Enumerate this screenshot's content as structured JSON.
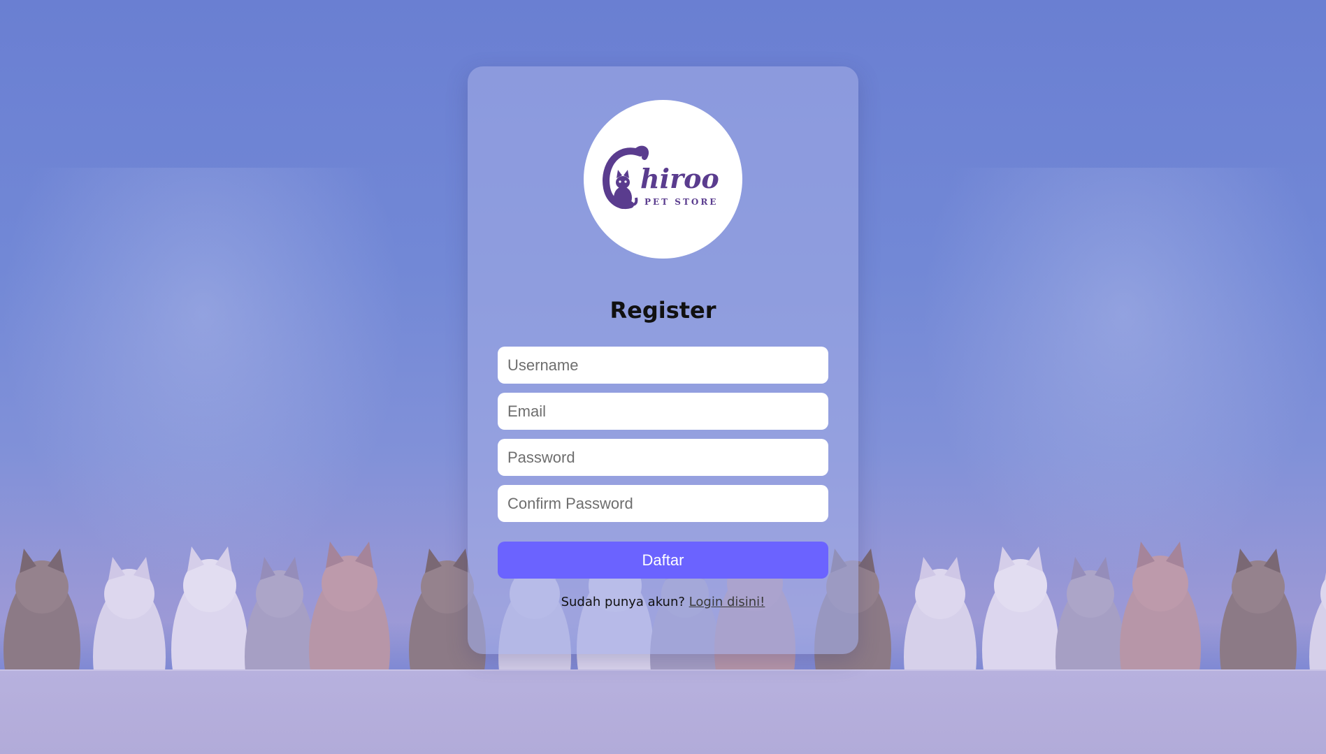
{
  "logo": {
    "brand_text": "hiroo",
    "tagline": "PET STORE",
    "icon": "cat-icon"
  },
  "form": {
    "title": "Register",
    "username_placeholder": "Username",
    "email_placeholder": "Email",
    "password_placeholder": "Password",
    "confirm_password_placeholder": "Confirm Password",
    "submit_label": "Daftar"
  },
  "footer": {
    "prompt": "Sudah punya akun?",
    "login_link": "Login disini!"
  },
  "colors": {
    "accent": "#6b63ff",
    "brand_purple": "#5a3c8e",
    "background": "#6a7fd2"
  }
}
